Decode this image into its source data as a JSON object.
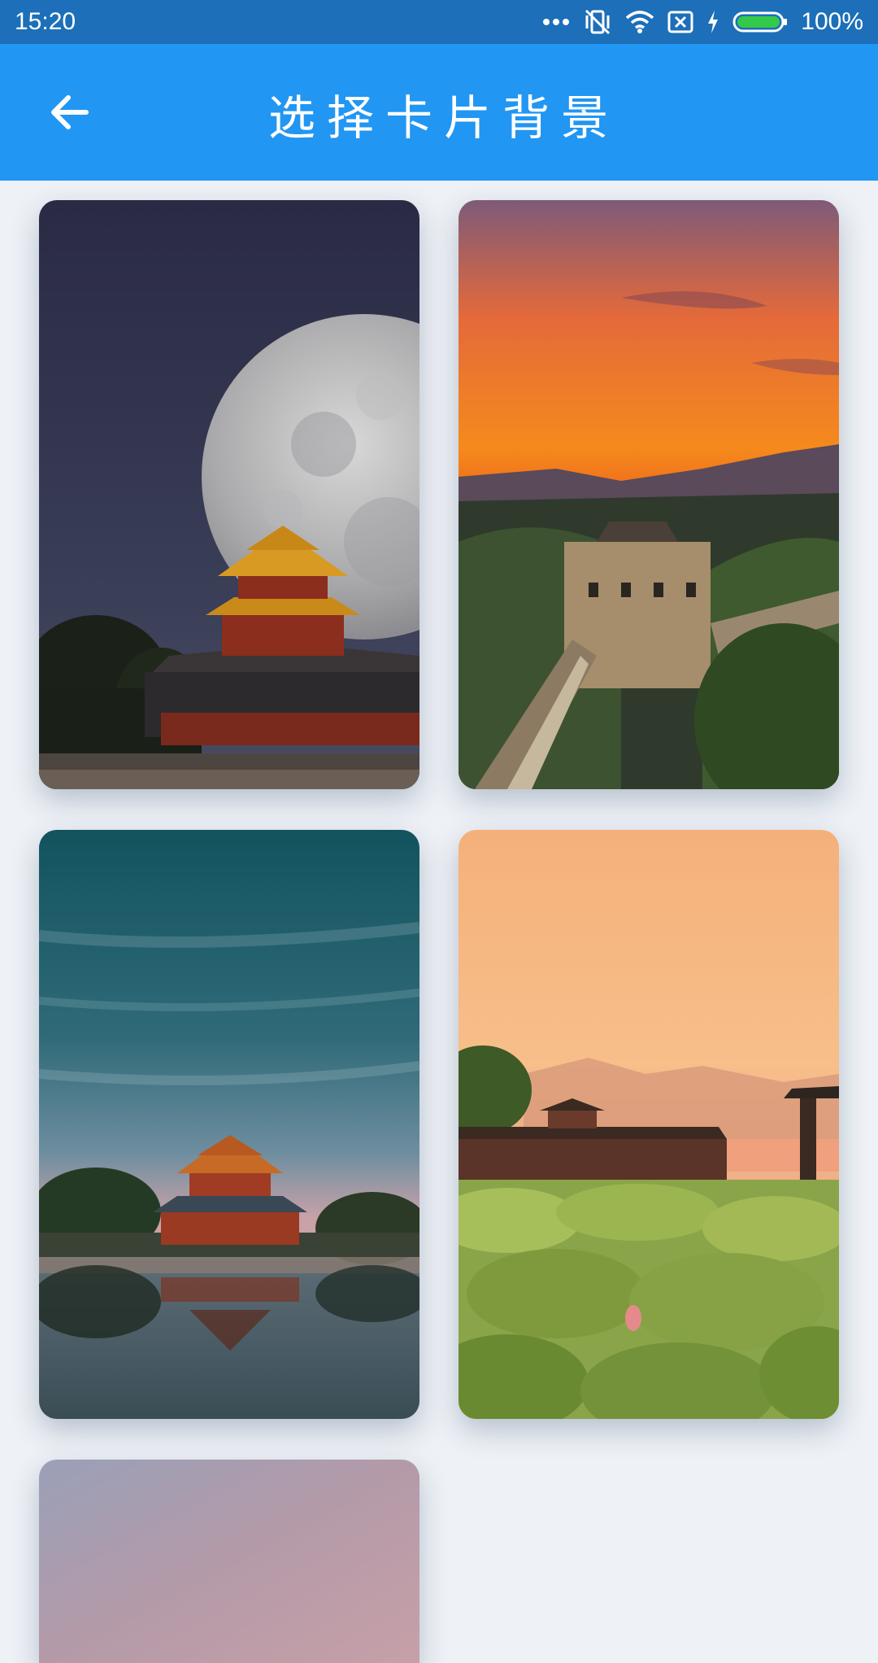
{
  "status_bar": {
    "time": "15:20",
    "icons": [
      "more-dots-icon",
      "vibrate-off-icon",
      "wifi-icon",
      "sim-x-icon",
      "charging-icon",
      "battery-icon"
    ],
    "battery_percent": "100%",
    "battery_color": "#35c94a"
  },
  "app_bar": {
    "back_icon": "arrow-left-icon",
    "title": "选择卡片背景",
    "color": "#2196f3"
  },
  "backgrounds": [
    {
      "id": "forbidden-city-moon"
    },
    {
      "id": "great-wall-sunset"
    },
    {
      "id": "corner-tower-reflection"
    },
    {
      "id": "lotus-pavilion"
    },
    {
      "id": "dusk-partial"
    }
  ]
}
